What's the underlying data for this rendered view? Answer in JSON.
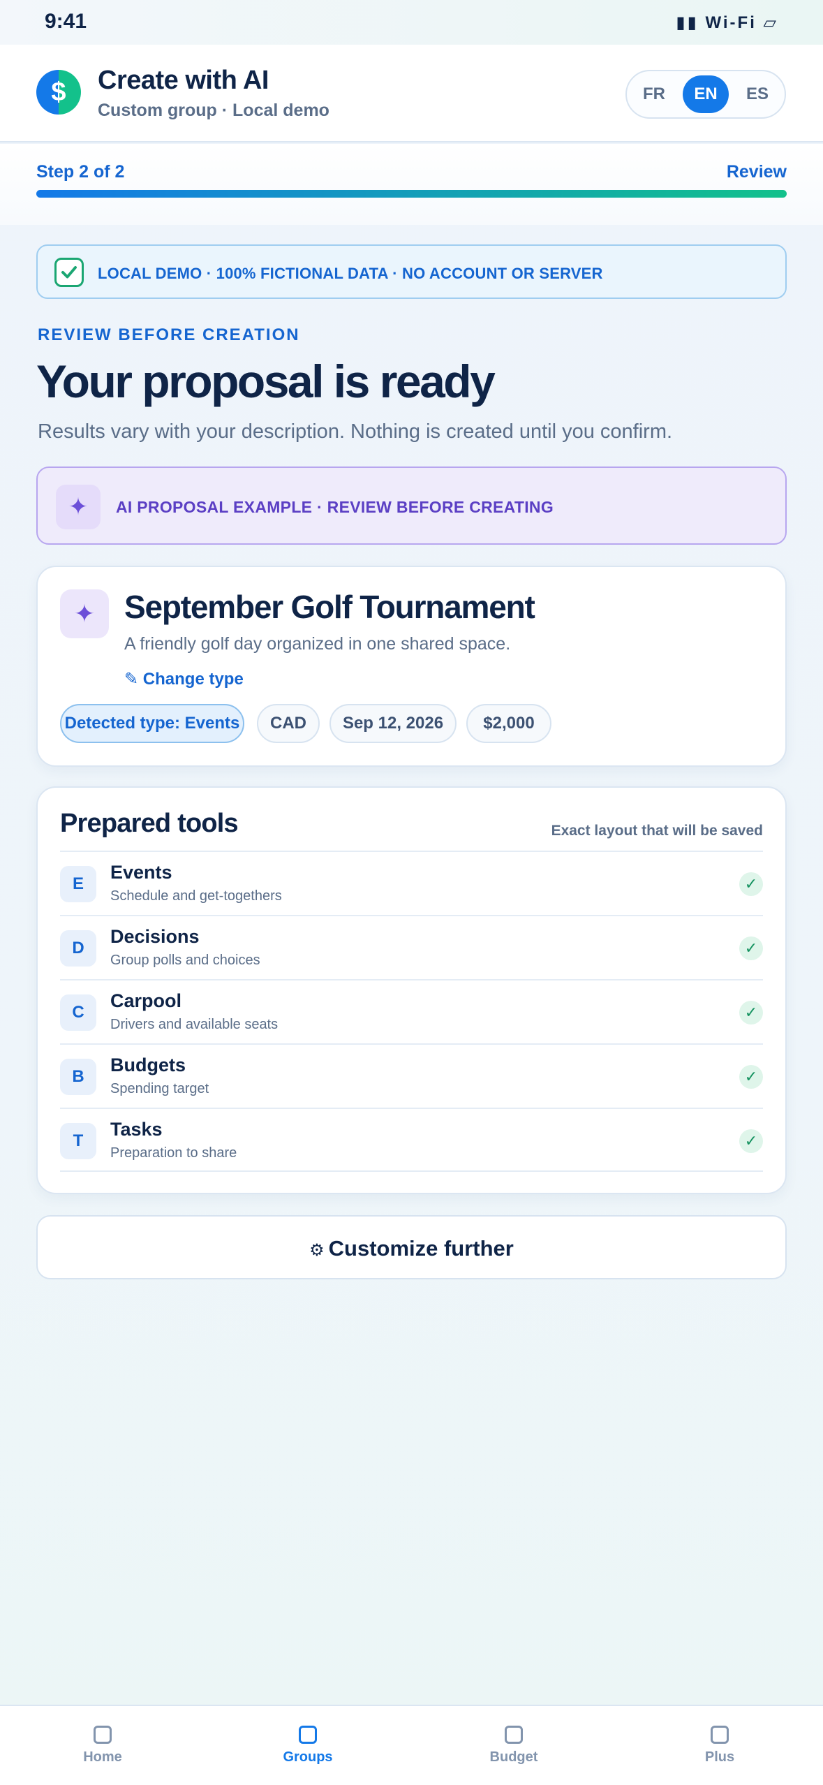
{
  "status_bar": {
    "time": "9:41",
    "right": "▮▮ Wi-Fi ▱"
  },
  "header": {
    "logo_glyph": "$",
    "title": "Create with AI",
    "subtitle": "Custom group · Local demo",
    "languages": [
      "FR",
      "EN",
      "ES"
    ],
    "active_language": "EN"
  },
  "step": {
    "label": "Step 2 of 2",
    "right_label": "Review",
    "progress": 1.0
  },
  "demo_banner": {
    "text": "LOCAL DEMO · 100% FICTIONAL DATA · NO ACCOUNT OR SERVER"
  },
  "review": {
    "eyebrow": "REVIEW BEFORE CREATION",
    "title": "Your proposal is ready",
    "subtitle": "Results vary with your description. Nothing is created until you confirm."
  },
  "ai_banner": {
    "icon": "sparkle-icon",
    "glyph": "✦",
    "text": "AI PROPOSAL EXAMPLE · REVIEW BEFORE CREATING"
  },
  "event": {
    "glyph": "✦",
    "title": "September Golf Tournament",
    "description": "A friendly golf day organized in one shared space.",
    "change_type": "✎ Change type",
    "chips": {
      "type": "Detected type: Events",
      "currency": "CAD",
      "date": "Sep 12, 2026",
      "amount": "$2,000"
    }
  },
  "tools": {
    "title": "Prepared tools",
    "note": "Exact layout that will be saved",
    "check_glyph": "✓",
    "items": [
      {
        "letter": "E",
        "name": "Events",
        "description": "Schedule and get-togethers"
      },
      {
        "letter": "D",
        "name": "Decisions",
        "description": "Group polls and choices"
      },
      {
        "letter": "C",
        "name": "Carpool",
        "description": "Drivers and available seats"
      },
      {
        "letter": "B",
        "name": "Budgets",
        "description": "Spending target"
      },
      {
        "letter": "T",
        "name": "Tasks",
        "description": "Preparation to share"
      }
    ]
  },
  "customize": {
    "gear_glyph": "⚙",
    "label": "Customize further"
  },
  "bottom_nav": {
    "items": [
      "Home",
      "Groups",
      "Budget",
      "Plus"
    ],
    "active": "Groups"
  },
  "colors": {
    "primary": "#1479e8",
    "accent_green": "#13c18b",
    "ai_purple": "#6c4fd8",
    "text_dark": "#0f2447",
    "text_muted": "#5a6d88"
  }
}
